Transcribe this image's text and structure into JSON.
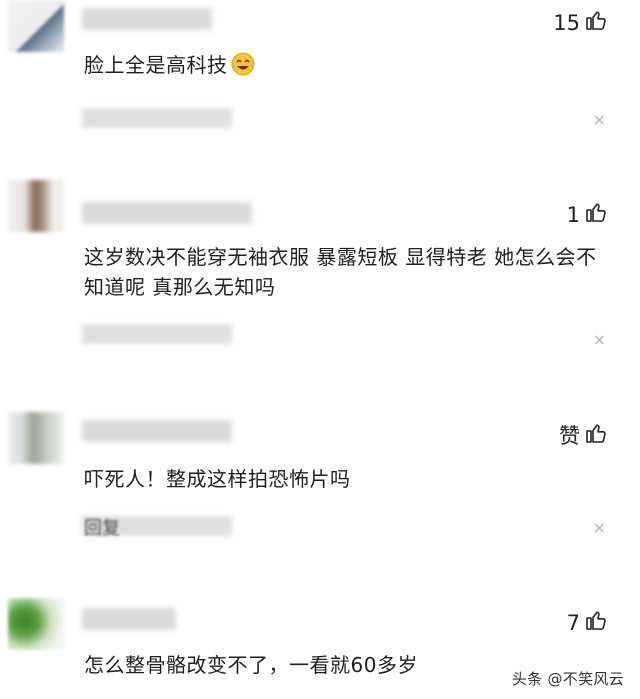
{
  "comments": [
    {
      "text": "脸上全是高科技",
      "likes": "15",
      "emoji": "laughing-crying-emoji"
    },
    {
      "text": "这岁数决不能穿无袖衣服 暴露短板 显得特老 她怎么会不知道呢 真那么无知吗",
      "likes": "1"
    },
    {
      "text": "吓死人！整成这样拍恐怖片吗",
      "likes": "赞",
      "reply_fragment": "回复"
    },
    {
      "text": "怎么整骨骼改变不了，一看就60多岁",
      "likes": "7"
    }
  ],
  "close_glyph": "×",
  "watermark": "头条 @不笑风云",
  "icons": {
    "like": "thumbs-up-icon",
    "close": "close-icon"
  }
}
